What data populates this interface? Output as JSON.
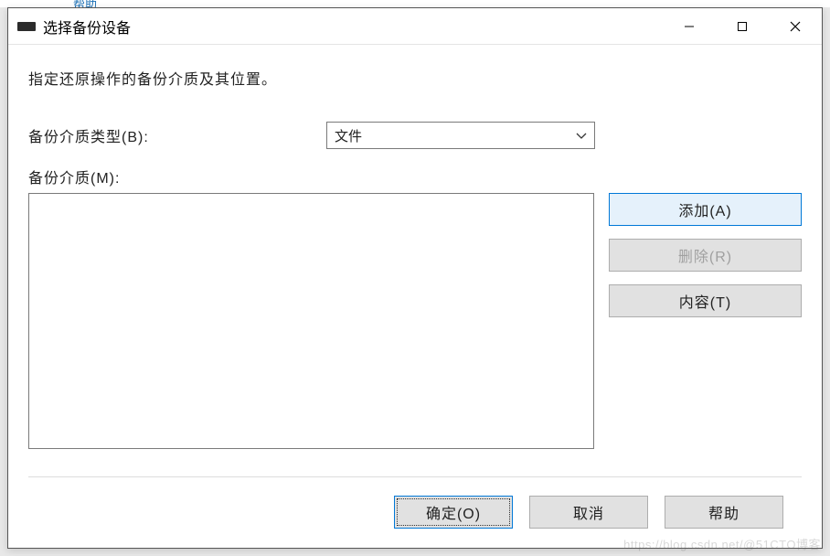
{
  "background": {
    "fragment": "帮助"
  },
  "titlebar": {
    "title": "选择备份设备"
  },
  "body": {
    "instruction": "指定还原操作的备份介质及其位置。",
    "media_type_label": "备份介质类型(B):",
    "media_type_value": "文件",
    "media_label": "备份介质(M):"
  },
  "side_buttons": {
    "add": "添加(A)",
    "delete": "删除(R)",
    "content": "内容(T)"
  },
  "footer": {
    "ok": "确定(O)",
    "cancel": "取消",
    "help": "帮助"
  },
  "watermark": "https://blog.csdn.net/@51CTO博客"
}
